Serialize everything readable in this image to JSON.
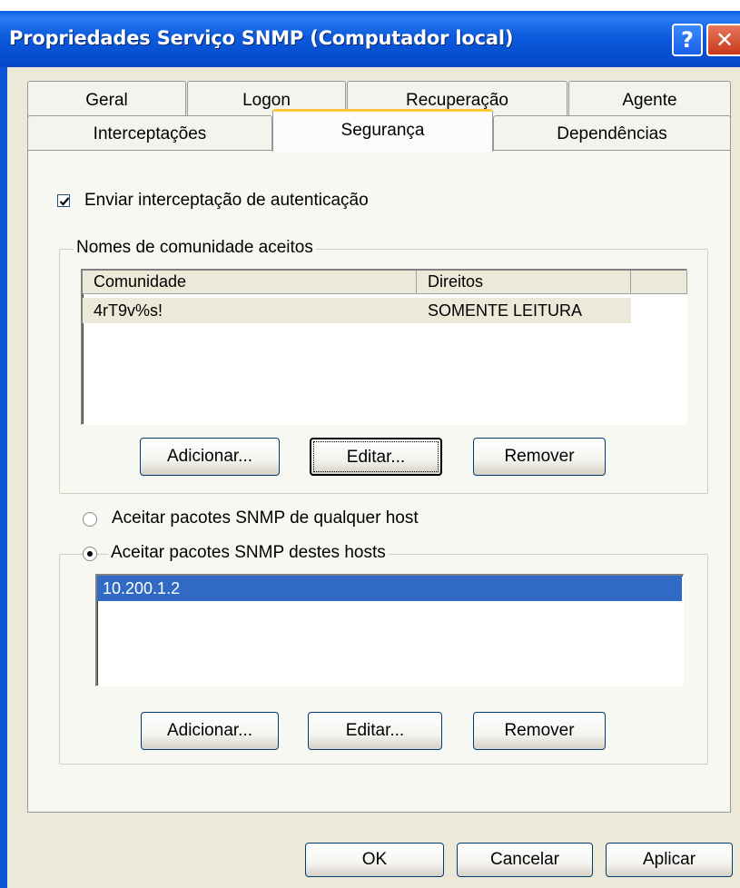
{
  "window": {
    "title": "Propriedades Serviço SNMP (Computador local)",
    "help_glyph": "?",
    "close_glyph": "✕",
    "colors": {
      "titlebar": "#0750D2",
      "face": "#ECE9D8",
      "selection": "#316AC5",
      "tab_highlight": "#FFC83C"
    }
  },
  "tabs_row1": [
    {
      "label": "Geral"
    },
    {
      "label": "Logon"
    },
    {
      "label": "Recuperação"
    },
    {
      "label": "Agente"
    }
  ],
  "tabs_row2": [
    {
      "label": "Interceptações"
    },
    {
      "label": "Segurança",
      "active": true
    },
    {
      "label": "Dependências"
    }
  ],
  "security": {
    "send_auth_trap": {
      "label": "Enviar interceptação de autenticação",
      "checked": true
    },
    "communities": {
      "group_label": "Nomes de comunidade aceitos",
      "columns": [
        "Comunidade",
        "Direitos"
      ],
      "rows": [
        {
          "community": "4rT9v%s!",
          "rights": "SOMENTE LEITURA"
        }
      ],
      "buttons": {
        "add": "Adicionar...",
        "edit": "Editar...",
        "remove": "Remover"
      }
    },
    "hosts": {
      "radio_any": {
        "label": "Aceitar pacotes SNMP de qualquer host",
        "selected": false
      },
      "radio_these": {
        "label": "Aceitar pacotes SNMP destes hosts",
        "selected": true
      },
      "items": [
        "10.200.1.2"
      ],
      "buttons": {
        "add": "Adicionar...",
        "edit": "Editar...",
        "remove": "Remover"
      }
    }
  },
  "footer": {
    "ok": "OK",
    "cancel": "Cancelar",
    "apply": "Aplicar"
  }
}
